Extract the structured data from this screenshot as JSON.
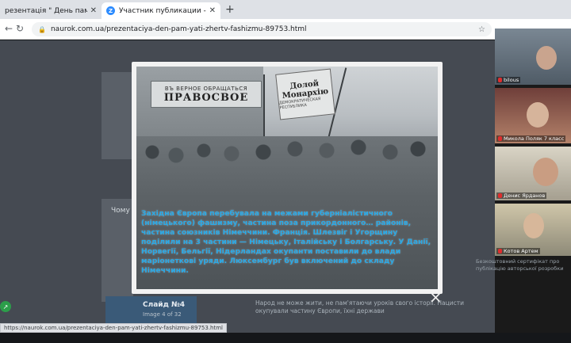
{
  "browser": {
    "tabs": [
      {
        "title": "резентація \" День пам'яті жер",
        "active": false
      },
      {
        "title": "Участник публикации - Zoom",
        "active": true,
        "icon": "zoom-icon"
      }
    ],
    "new_tab": "+",
    "url": "naurok.com.ua/prezentaciya-den-pam-yati-zhertv-fashizmu-89753.html",
    "status_url": "https://naurok.com.ua/prezentaciya-den-pam-yati-zhertv-fashizmu-89753.html"
  },
  "lightbox": {
    "photo_sign_small": "ВЪ ВЕРНОЕ ОБРАЩАТЬСЯ",
    "photo_sign": "ПРАВОСВОЕ",
    "banner_line1": "Долой",
    "banner_line2": "Монархію",
    "banner_sub": "ДЕМОКРАТИЧЕСКАЯ РЕСПУБЛИКА",
    "caption": "Західна Європа перебувала на межами губерніалістичного (німецького) фашизму, частина поза прикордонного… районів, частина союзників Німеччини. Франція. Шлезвіг і Угорщину поділили на 3 частини — Німецьку, Італійську і Болгарську. У Данії, Норвегії, Бельгії, Нідерландах окупанти поставили до влади маріонеткові уряди. Люксембург був включений до складу Німеччини.",
    "close": "×"
  },
  "page": {
    "slide_title": "Слайд №4",
    "slide_sub": "Image 4 of 32",
    "left_text": "Чому у",
    "below_text": "Народ не може жити, не пам'ятаючи уроків свого історії. Нацисти окупували частину Європи, їхні держави",
    "side_text": "Безкоштовний сертифікат про публікацію авторської розробки"
  },
  "zoom": {
    "participants": [
      {
        "name": "bilous",
        "muted": true
      },
      {
        "name": "Микола Поляк 7 класс",
        "muted": true
      },
      {
        "name": "Денис Ярданов",
        "muted": true
      },
      {
        "name": "Котов Артем",
        "muted": true
      }
    ]
  },
  "colors": {
    "caption": "#2aa9e6",
    "zoom_blue": "#2d8cff",
    "mic_red": "#e02d2d"
  }
}
